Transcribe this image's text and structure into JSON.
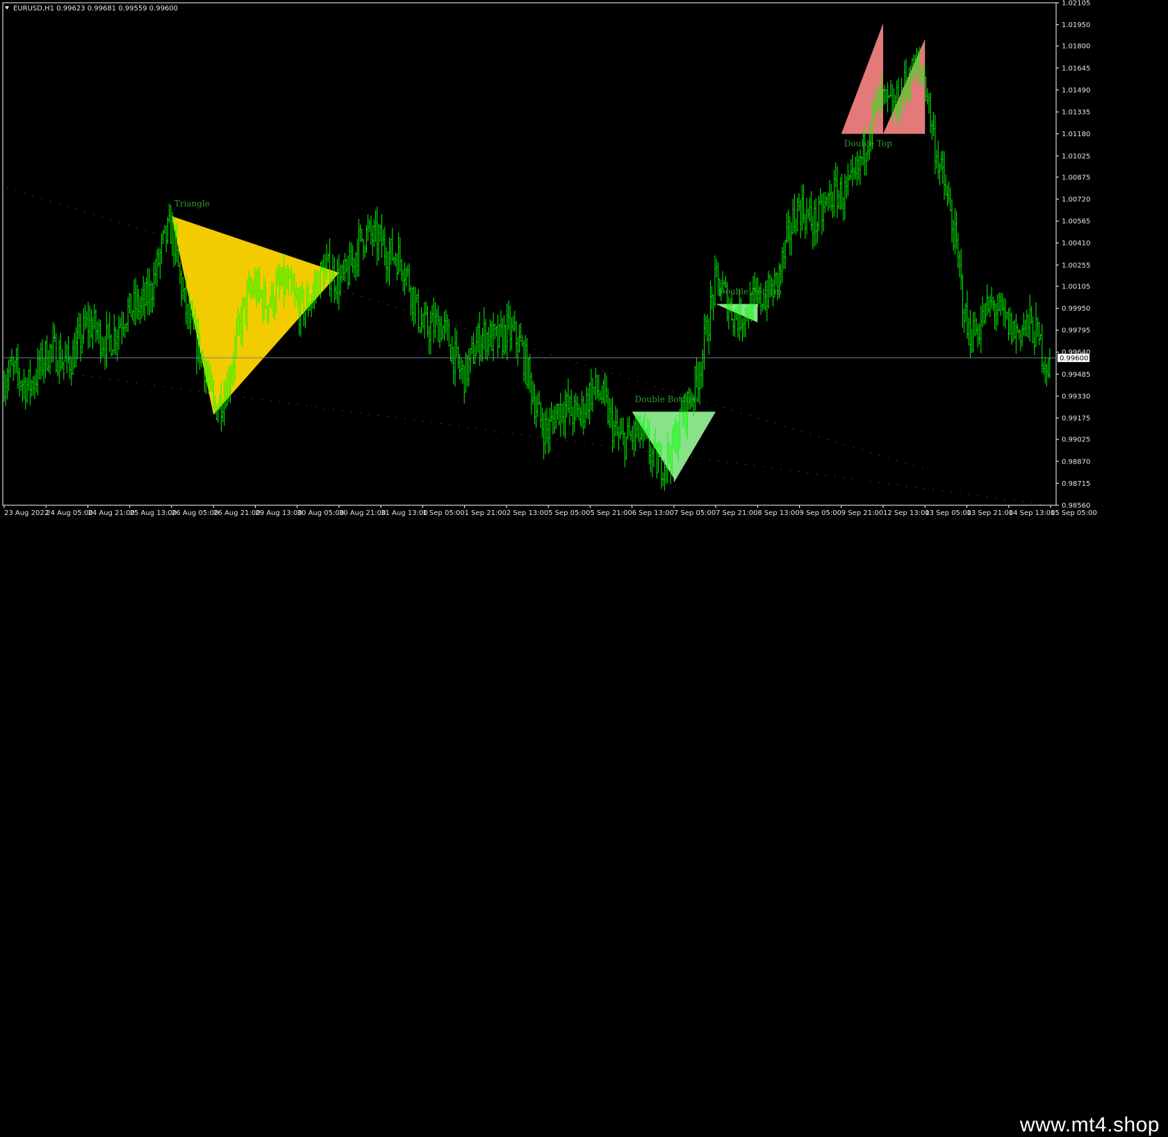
{
  "header": {
    "symbol": "EURUSD,H1",
    "ohlc": "0.99623 0.99681 0.99559 0.99600"
  },
  "colors": {
    "background": "#000000",
    "candles": "#00ff00",
    "triangle_fill": "#ffd700",
    "double_top_fill": "#f08080",
    "double_bottom_fill": "#90ee90",
    "pattern_label": "#2e9d2e",
    "bid_line": "#708090"
  },
  "watermark": "www.mt4.shop",
  "chart_data": {
    "type": "line",
    "style": "hlc-bars",
    "symbol": "EURUSD",
    "timeframe": "H1",
    "ylim": [
      0.9856,
      1.02105
    ],
    "yticks": [
      "1.02105",
      "1.01950",
      "1.01800",
      "1.01645",
      "1.01490",
      "1.01335",
      "1.01180",
      "1.01025",
      "1.00875",
      "1.00720",
      "1.00565",
      "1.00410",
      "1.00255",
      "1.00105",
      "0.99950",
      "0.99795",
      "0.99640",
      "0.99485",
      "0.99330",
      "0.99175",
      "0.99025",
      "0.98870",
      "0.98715",
      "0.98560"
    ],
    "xticks": [
      "23 Aug 2022",
      "24 Aug 05:00",
      "24 Aug 21:00",
      "25 Aug 13:00",
      "26 Aug 05:00",
      "26 Aug 21:00",
      "29 Aug 13:00",
      "30 Aug 05:00",
      "30 Aug 21:00",
      "31 Aug 13:00",
      "1 Sep 05:00",
      "1 Sep 21:00",
      "2 Sep 13:00",
      "5 Sep 05:00",
      "5 Sep 21:00",
      "6 Sep 13:00",
      "7 Sep 05:00",
      "7 Sep 21:00",
      "8 Sep 13:00",
      "9 Sep 05:00",
      "9 Sep 21:00",
      "12 Sep 13:00",
      "13 Sep 05:00",
      "13 Sep 21:00",
      "14 Sep 13:00",
      "15 Sep 05:00"
    ],
    "current_price": "0.99600",
    "grid": false,
    "series": [
      {
        "x": [
          "23 Aug 2022",
          "24 Aug 05:00",
          "24 Aug 21:00",
          "25 Aug 13:00",
          "26 Aug 05:00",
          "26 Aug 21:00",
          "29 Aug 13:00",
          "30 Aug 05:00",
          "30 Aug 21:00",
          "31 Aug 13:00",
          "1 Sep 05:00",
          "1 Sep 21:00",
          "2 Sep 13:00",
          "5 Sep 05:00",
          "5 Sep 21:00",
          "6 Sep 13:00",
          "7 Sep 05:00",
          "7 Sep 21:00",
          "8 Sep 13:00",
          "9 Sep 05:00",
          "9 Sep 21:00",
          "12 Sep 13:00",
          "13 Sep 05:00",
          "13 Sep 21:00",
          "14 Sep 13:00",
          "15 Sep 05:00"
        ],
        "y": [
          0.994,
          0.9955,
          0.9975,
          0.9985,
          1.0045,
          0.992,
          1.001,
          1.0,
          1.002,
          1.005,
          0.999,
          0.9955,
          0.9985,
          0.991,
          0.9935,
          0.99,
          0.989,
          1.0005,
          0.999,
          1.006,
          1.007,
          1.014,
          1.016,
          0.9985,
          0.999,
          0.996
        ]
      }
    ],
    "patterns": [
      {
        "name": "Triangle",
        "color": "#ffd700",
        "points": [
          [
            "26 Aug 05:00",
            1.006
          ],
          [
            "26 Aug 21:00",
            0.992
          ],
          [
            "30 Aug 21:00",
            1.002
          ]
        ]
      },
      {
        "name": "Double Top",
        "color": "#f08080",
        "points": [
          [
            "9 Sep 21:00",
            1.0118
          ],
          [
            "12 Sep 13:00",
            1.0196
          ],
          [
            "12 Sep 13:00",
            1.0118
          ],
          [
            "13 Sep 05:00",
            1.0185
          ],
          [
            "13 Sep 05:00",
            1.0118
          ]
        ]
      },
      {
        "name": "Double Bottom",
        "color": "#90ee90",
        "points": [
          [
            "6 Sep 13:00",
            0.9922
          ],
          [
            "7 Sep 05:00",
            0.9875
          ],
          [
            "7 Sep 05:00",
            0.9922
          ],
          [
            "7 Sep 05:00",
            0.9872
          ],
          [
            "7 Sep 21:00",
            0.9922
          ]
        ]
      },
      {
        "name": "Double Bottom",
        "color": "#90ee90",
        "points": [
          [
            "7 Sep 21:00",
            0.9998
          ],
          [
            "8 Sep 13:00",
            0.9985
          ],
          [
            "8 Sep 13:00",
            0.9998
          ]
        ]
      }
    ]
  }
}
